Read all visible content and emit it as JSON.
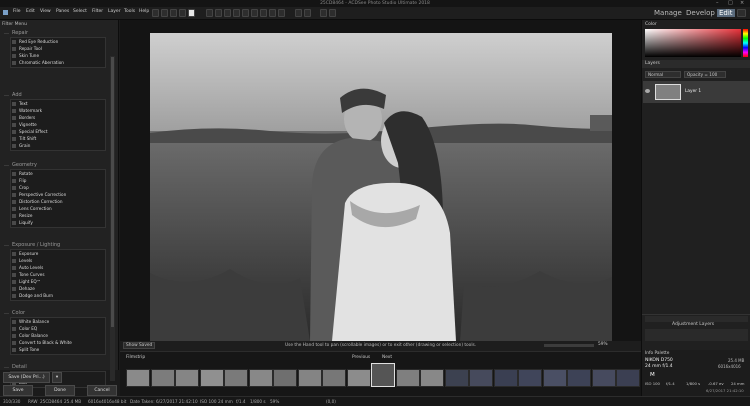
{
  "window": {
    "title": "25CD8464 - ACDSee Photo Studio Ultimate 2018",
    "controls": [
      "–",
      "□",
      "×"
    ]
  },
  "menu": [
    "File",
    "Edit",
    "View",
    "Panes",
    "Select",
    "Filter",
    "Layer",
    "Tools",
    "Help"
  ],
  "modes": {
    "manage": "Manage",
    "develop": "Develop",
    "edit": "Edit"
  },
  "left_panel": {
    "title": "Filter Menu",
    "categories": [
      {
        "name": "Repair",
        "items": [
          "Red Eye Reduction",
          "Repair Tool",
          "Skin Tune",
          "Chromatic Aberration"
        ]
      },
      {
        "name": "Add",
        "items": [
          "Text",
          "Watermark",
          "Borders",
          "Vignette",
          "Special Effect",
          "Tilt Shift",
          "Grain"
        ]
      },
      {
        "name": "Geometry",
        "items": [
          "Rotate",
          "Flip",
          "Crop",
          "Perspective Correction",
          "Distortion Correction",
          "Lens Correction",
          "Resize",
          "Liquify"
        ]
      },
      {
        "name": "Exposure / Lighting",
        "items": [
          "Exposure",
          "Levels",
          "Auto Levels",
          "Tone Curves",
          "Light EQ™",
          "Dehaze",
          "Dodge and Burn"
        ]
      },
      {
        "name": "Color",
        "items": [
          "White Balance",
          "Color EQ",
          "Color Balance",
          "Convert to Black & White",
          "Split Tone"
        ]
      },
      {
        "name": "Detail",
        "items": [
          "Sharpen",
          "Blur"
        ]
      }
    ],
    "save_as_label": "Save (Dev Pri...)",
    "save_label": "Save",
    "done_label": "Done",
    "cancel_label": "Cancel"
  },
  "canvas": {
    "show_saved": "Show Saved",
    "hint": "Use the Hand tool to pan (scrollable images) or to exit other (drawing or selection) tools.",
    "zoom": "59%"
  },
  "filmstrip": {
    "title": "Filmstrip",
    "previous": "Previous",
    "next": "Next"
  },
  "right_panel": {
    "color_title": "Color",
    "layers_title": "Layers",
    "blend_mode": "Normal",
    "opacity": "Opacity = 100",
    "layer_name": "Layer 1",
    "adjustment_layers_title": "Adjustment Layers",
    "info_title": "Info Palette",
    "info": {
      "camera": "NIKON D750",
      "lens": "24 mm f/1.4",
      "iso": "ISO 100",
      "shutter": "1/800 s",
      "ev": "-0.67 ev",
      "focal": "24 mm",
      "flash": "f/1.4",
      "mode": "M",
      "date": "6/27/2017 21:42:10",
      "size_mb": "25.4 MB",
      "resolution": "6016x4016"
    }
  },
  "statusbar": {
    "index": "310/330",
    "format": "RAW",
    "filename": "25CD8464",
    "size": "25.4 MB",
    "dimensions": "6016x4016x48 bit",
    "date": "Date Taken: 6/27/2017 21:42:10",
    "iso": "ISO 100",
    "focal": "24 mm",
    "aperture": "f/1.4",
    "shutter": "1/800 s",
    "zoom": "59%",
    "coords": "(0,0)"
  }
}
